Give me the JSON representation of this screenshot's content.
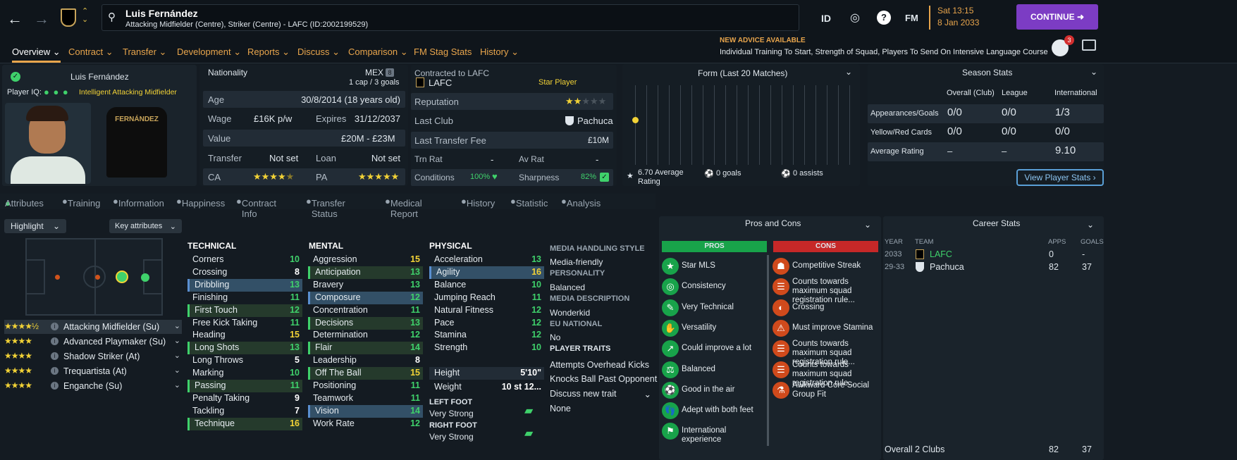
{
  "header": {
    "name": "Luis Fernández",
    "subtitle": "Attacking Midfielder (Centre), Striker (Centre) - LAFC (ID:2002199529)",
    "id_label": "ID",
    "fm_label": "FM",
    "date_line1": "Sat 13:15",
    "date_line2": "8 Jan 2033",
    "continue_label": "CONTINUE",
    "badge_count": "3",
    "colors": {
      "accent": "#e8a54c",
      "continue": "#7c3cc4",
      "good": "#3fd16b"
    }
  },
  "nav": {
    "items": [
      "Overview",
      "Contract",
      "Transfer",
      "Development",
      "Reports",
      "Discuss",
      "Comparison",
      "FM Stag Stats",
      "History"
    ],
    "advice_title": "NEW ADVICE AVAILABLE",
    "advice_text": "Individual Training To Start, Strength of Squad, Players To Send On Intensive Language Course"
  },
  "profile": {
    "name": "Luis Fernández",
    "iq_label": "Player IQ:",
    "iq_text": "Intelligent Attacking Midfielder",
    "shirt_name": "FERNÁNDEZ"
  },
  "info": {
    "nationality_label": "Nationality",
    "nation": "MEX",
    "nation_rank": "8",
    "caps": "1 cap / 3 goals",
    "age_label": "Age",
    "age": "30/8/2014 (18 years old)",
    "wage_label": "Wage",
    "wage": "£16K p/w",
    "expires_label": "Expires",
    "expires": "31/12/2037",
    "value_label": "Value",
    "value": "£20M - £23M",
    "transfer_label": "Transfer",
    "transfer": "Not set",
    "loan_label": "Loan",
    "loan": "Not set",
    "ca_label": "CA",
    "pa_label": "PA",
    "ca_stars": 4.5,
    "pa_stars": 5
  },
  "contract": {
    "contracted_label": "Contracted to LAFC",
    "club": "LAFC",
    "status": "Star Player",
    "reputation_label": "Reputation",
    "reputation_stars": 2,
    "last_club_label": "Last Club",
    "last_club": "Pachuca",
    "fee_label": "Last Transfer Fee",
    "fee": "£10M",
    "trn_label": "Trn Rat",
    "trn": "-",
    "av_label": "Av Rat",
    "av": "-",
    "conditions_label": "Conditions",
    "conditions": "100%",
    "sharpness_label": "Sharpness",
    "sharpness": "82%"
  },
  "form": {
    "title": "Form (Last 20 Matches)",
    "rating": "6.70 Average Rating",
    "goals": "0 goals",
    "assists": "0 assists",
    "points": [
      6.7
    ]
  },
  "season": {
    "title": "Season Stats",
    "cols": [
      "Overall (Club)",
      "League",
      "International"
    ],
    "rows": [
      {
        "label": "Appearances/Goals",
        "vals": [
          "0/0",
          "0/0",
          "1/3"
        ]
      },
      {
        "label": "Yellow/Red Cards",
        "vals": [
          "0/0",
          "0/0",
          "0/0"
        ]
      },
      {
        "label": "Average Rating",
        "vals": [
          "–",
          "–",
          "9.10"
        ]
      }
    ],
    "view_label": "View Player Stats"
  },
  "tabs": [
    "Attributes",
    "Training",
    "Information",
    "Happiness",
    "Contract Info",
    "Transfer Status",
    "Medical Report",
    "History",
    "Statistic",
    "Analysis"
  ],
  "controls": {
    "highlight": "Highlight",
    "key_attributes": "Key attributes"
  },
  "roles": [
    {
      "name": "Attacking Midfielder (Su)",
      "stars": "★★★★½"
    },
    {
      "name": "Advanced Playmaker (Su)",
      "stars": "★★★★"
    },
    {
      "name": "Shadow Striker (At)",
      "stars": "★★★★"
    },
    {
      "name": "Trequartista (At)",
      "stars": "★★★★"
    },
    {
      "name": "Enganche (Su)",
      "stars": "★★★★"
    }
  ],
  "technical": {
    "title": "TECHNICAL",
    "items": [
      [
        "Corners",
        "10"
      ],
      [
        "Crossing",
        "8"
      ],
      [
        "Dribbling",
        "13"
      ],
      [
        "Finishing",
        "11"
      ],
      [
        "First Touch",
        "12"
      ],
      [
        "Free Kick Taking",
        "11"
      ],
      [
        "Heading",
        "15"
      ],
      [
        "Long Shots",
        "13"
      ],
      [
        "Long Throws",
        "5"
      ],
      [
        "Marking",
        "10"
      ],
      [
        "Passing",
        "11"
      ],
      [
        "Penalty Taking",
        "9"
      ],
      [
        "Tackling",
        "7"
      ],
      [
        "Technique",
        "16"
      ]
    ]
  },
  "mental": {
    "title": "MENTAL",
    "items": [
      [
        "Aggression",
        "15"
      ],
      [
        "Anticipation",
        "13"
      ],
      [
        "Bravery",
        "13"
      ],
      [
        "Composure",
        "12"
      ],
      [
        "Concentration",
        "11"
      ],
      [
        "Decisions",
        "13"
      ],
      [
        "Determination",
        "12"
      ],
      [
        "Flair",
        "14"
      ],
      [
        "Leadership",
        "8"
      ],
      [
        "Off The Ball",
        "15"
      ],
      [
        "Positioning",
        "11"
      ],
      [
        "Teamwork",
        "11"
      ],
      [
        "Vision",
        "14"
      ],
      [
        "Work Rate",
        "12"
      ]
    ]
  },
  "physical": {
    "title": "PHYSICAL",
    "items": [
      [
        "Acceleration",
        "13"
      ],
      [
        "Agility",
        "16"
      ],
      [
        "Balance",
        "10"
      ],
      [
        "Jumping Reach",
        "11"
      ],
      [
        "Natural Fitness",
        "12"
      ],
      [
        "Pace",
        "12"
      ],
      [
        "Stamina",
        "12"
      ],
      [
        "Strength",
        "10"
      ]
    ],
    "height_label": "Height",
    "height": "5'10\"",
    "weight_label": "Weight",
    "weight": "10 st 12...",
    "left_foot_label": "LEFT FOOT",
    "left_foot": "Very Strong",
    "right_foot_label": "RIGHT FOOT",
    "right_foot": "Very Strong"
  },
  "media": {
    "style_label": "MEDIA HANDLING STYLE",
    "style": "Media-friendly",
    "personality_label": "PERSONALITY",
    "personality": "Balanced",
    "desc_label": "MEDIA DESCRIPTION",
    "desc": "Wonderkid",
    "eu_label": "EU NATIONAL",
    "eu": "No",
    "traits_label": "PLAYER TRAITS",
    "traits": [
      "Attempts Overhead Kicks",
      "Knocks Ball Past Opponent"
    ],
    "discuss_label": "Discuss new trait",
    "discuss_value": "None"
  },
  "pros_cons": {
    "title": "Pros and Cons",
    "pros_label": "PROS",
    "cons_label": "CONS",
    "pros": [
      "Star MLS",
      "Consistency",
      "Very Technical",
      "Versatility",
      "Could improve a lot",
      "Balanced",
      "Good in the air",
      "Adept with both feet",
      "International experience"
    ],
    "cons": [
      "Competitive Streak",
      "Counts towards maximum squad registration rule...",
      "Crossing",
      "Must improve Stamina",
      "Counts towards maximum squad registration rule...",
      "Counts towards maximum squad registration rule...",
      "Awkward Core Social Group Fit"
    ]
  },
  "career": {
    "title": "Career Stats",
    "cols": [
      "YEAR",
      "TEAM",
      "APPS",
      "GOALS"
    ],
    "rows": [
      {
        "year": "2033",
        "team": "LAFC",
        "apps": "0",
        "goals": "-"
      },
      {
        "year": "29-33",
        "team": "Pachuca",
        "apps": "82",
        "goals": "37"
      }
    ],
    "overall_label": "Overall",
    "overall_clubs": "2 Clubs",
    "overall_apps": "82",
    "overall_goals": "37"
  }
}
